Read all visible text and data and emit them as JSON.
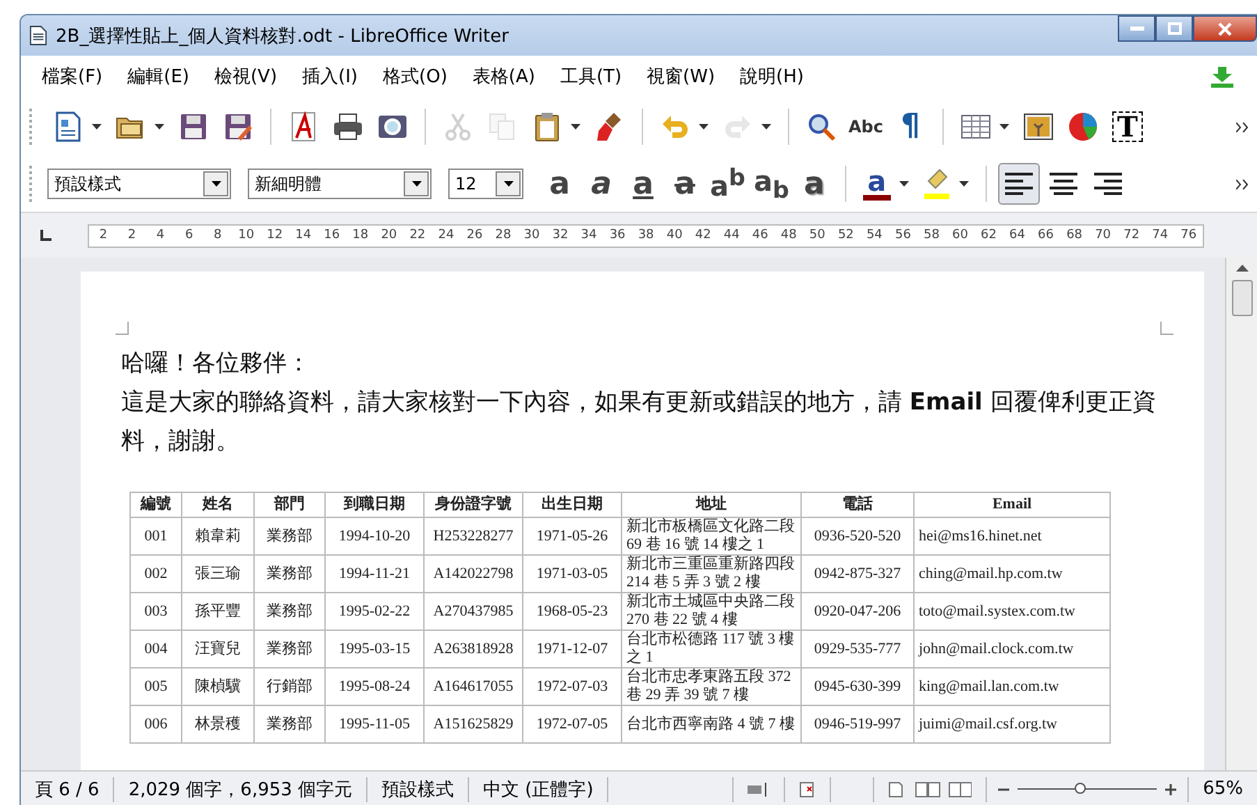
{
  "window": {
    "title": "2B_選擇性貼上_個人資料核對.odt - LibreOffice Writer"
  },
  "menu": [
    "檔案(F)",
    "編輯(E)",
    "檢視(V)",
    "插入(I)",
    "格式(O)",
    "表格(A)",
    "工具(T)",
    "視窗(W)",
    "說明(H)"
  ],
  "toolbar": [
    {
      "kind": "document",
      "dropdown": true,
      "disabled": false
    },
    {
      "kind": "folder",
      "dropdown": true,
      "disabled": false
    },
    {
      "kind": "floppy-disk",
      "dropdown": false,
      "disabled": false
    },
    {
      "kind": "floppy-pencil",
      "dropdown": false,
      "disabled": false,
      "sep": true
    },
    {
      "kind": "pdf",
      "dropdown": false,
      "disabled": false
    },
    {
      "kind": "printer",
      "dropdown": false,
      "disabled": false
    },
    {
      "kind": "page-magnifier",
      "dropdown": false,
      "disabled": false,
      "sep": true
    },
    {
      "kind": "scissors",
      "dropdown": false,
      "disabled": true
    },
    {
      "kind": "copy",
      "dropdown": false,
      "disabled": true
    },
    {
      "kind": "clipboard",
      "dropdown": true,
      "disabled": false
    },
    {
      "kind": "paintbrush",
      "dropdown": false,
      "disabled": false,
      "sep": true
    },
    {
      "kind": "undo",
      "dropdown": true,
      "disabled": false
    },
    {
      "kind": "redo",
      "dropdown": true,
      "disabled": true,
      "sep": true
    },
    {
      "kind": "magnifier",
      "dropdown": false,
      "disabled": false
    },
    {
      "kind": "spellcheck",
      "glyph": "Abc",
      "dropdown": false,
      "disabled": false
    },
    {
      "kind": "pilcrow",
      "glyph": "¶",
      "dropdown": false,
      "disabled": false,
      "sep": true
    },
    {
      "kind": "table",
      "dropdown": true,
      "disabled": false
    },
    {
      "kind": "picture",
      "dropdown": false,
      "disabled": false
    },
    {
      "kind": "pie-chart",
      "dropdown": false,
      "disabled": false
    },
    {
      "kind": "text-box",
      "glyph": "T",
      "dropdown": false,
      "disabled": false
    }
  ],
  "format_bar": {
    "style": "預設樣式",
    "font": "新細明體",
    "size": "12",
    "buttons": [
      {
        "kind": "bold",
        "glyph": "a"
      },
      {
        "kind": "italic",
        "glyph": "a"
      },
      {
        "kind": "underline",
        "glyph": "a"
      },
      {
        "kind": "strike",
        "glyph": "a"
      },
      {
        "kind": "superscript",
        "glyph": "a$^{b}$"
      },
      {
        "kind": "subscript",
        "glyph": "a$_{b}$"
      },
      {
        "kind": "shadow",
        "glyph": "a"
      },
      {
        "kind": "font-color",
        "glyph": "a",
        "color": "#8b0000"
      },
      {
        "kind": "highlight",
        "color": "#ffff00"
      }
    ],
    "align": [
      {
        "kind": "left",
        "selected": true
      },
      {
        "kind": "center",
        "selected": false
      },
      {
        "kind": "right",
        "selected": false
      }
    ]
  },
  "ruler": [
    "2",
    "2",
    "4",
    "6",
    "8",
    "10",
    "12",
    "14",
    "16",
    "18",
    "20",
    "22",
    "24",
    "26",
    "28",
    "30",
    "32",
    "34",
    "36",
    "38",
    "40",
    "42",
    "44",
    "46",
    "48",
    "50",
    "52",
    "54",
    "56",
    "58",
    "60",
    "62",
    "64",
    "66",
    "68",
    "70",
    "72",
    "74",
    "76"
  ],
  "document": {
    "greeting": "哈囉！各位夥伴：",
    "paragraph": "這是大家的聯絡資料，請大家核對一下內容，如果有更新或錯誤的地方，請 **Email** 回覆俾利更正資料，謝謝。",
    "table": {
      "columns": [
        "編號",
        "姓名",
        "部門",
        "到職日期",
        "身份證字號",
        "出生日期",
        "地址",
        "電話",
        "Email"
      ],
      "rows": [
        [
          "001",
          "賴韋莉",
          "業務部",
          "1994-10-20",
          "H253228277",
          "1971-05-26",
          "新北市板橋區文化路二段 69 巷 16 號 14 樓之 1",
          "0936-520-520",
          "hei@ms16.hinet.net"
        ],
        [
          "002",
          "張三瑜",
          "業務部",
          "1994-11-21",
          "A142022798",
          "1971-03-05",
          "新北市三重區重新路四段 214 巷 5 弄 3 號 2 樓",
          "0942-875-327",
          "ching@mail.hp.com.tw"
        ],
        [
          "003",
          "孫平豐",
          "業務部",
          "1995-02-22",
          "A270437985",
          "1968-05-23",
          "新北市土城區中央路二段 270 巷 22 號 4 樓",
          "0920-047-206",
          "toto@mail.systex.com.tw"
        ],
        [
          "004",
          "汪寶兒",
          "業務部",
          "1995-03-15",
          "A263818928",
          "1971-12-07",
          "台北市松德路 117 號 3 樓之 1",
          "0929-535-777",
          "john@mail.clock.com.tw"
        ],
        [
          "005",
          "陳楨驥",
          "行銷部",
          "1995-08-24",
          "A164617055",
          "1972-07-03",
          "台北市忠孝東路五段 372 巷 29 弄 39 號 7 樓",
          "0945-630-399",
          "king@mail.lan.com.tw"
        ],
        [
          "006",
          "林景穫",
          "業務部",
          "1995-11-05",
          "A151625829",
          "1972-07-05",
          "台北市西寧南路 4 號 7 樓",
          "0946-519-997",
          "juimi@mail.csf.org.tw"
        ]
      ]
    }
  },
  "status_bar": {
    "page": "頁 6 / 6",
    "count": "2,029 個字，6,953 個字元",
    "style": "預設樣式",
    "language": "中文 (正體字)",
    "zoom": {
      "level": 0.45,
      "reading": "65%"
    }
  }
}
